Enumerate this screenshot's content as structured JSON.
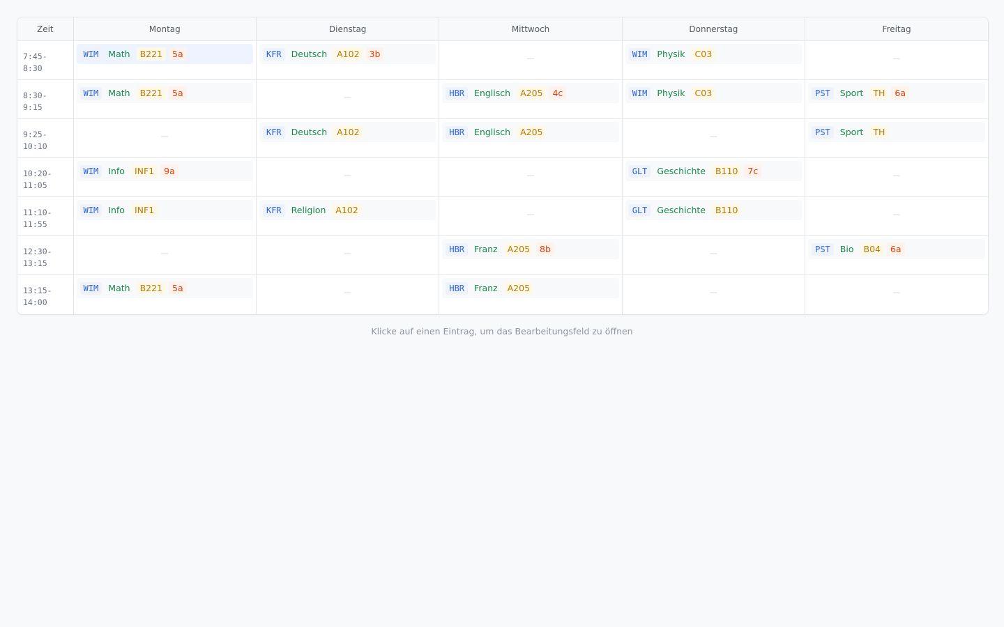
{
  "header": {
    "time_label": "Zeit",
    "days": [
      "Montag",
      "Dienstag",
      "Mittwoch",
      "Donnerstag",
      "Freitag"
    ]
  },
  "empty_marker": "—",
  "rows": [
    {
      "time": "7:45-\n8:30",
      "cells": [
        {
          "teacher": "WIM",
          "subject": "Math",
          "room": "B221",
          "class": "5a",
          "selected": true
        },
        {
          "teacher": "KFR",
          "subject": "Deutsch",
          "room": "A102",
          "class": "3b"
        },
        null,
        {
          "teacher": "WIM",
          "subject": "Physik",
          "room": "C03"
        },
        null
      ]
    },
    {
      "time": "8:30-\n9:15",
      "cells": [
        {
          "teacher": "WIM",
          "subject": "Math",
          "room": "B221",
          "class": "5a"
        },
        null,
        {
          "teacher": "HBR",
          "subject": "Englisch",
          "room": "A205",
          "class": "4c"
        },
        {
          "teacher": "WIM",
          "subject": "Physik",
          "room": "C03"
        },
        {
          "teacher": "PST",
          "subject": "Sport",
          "room": "TH",
          "class": "6a"
        }
      ]
    },
    {
      "time": "9:25-\n10:10",
      "cells": [
        null,
        {
          "teacher": "KFR",
          "subject": "Deutsch",
          "room": "A102"
        },
        {
          "teacher": "HBR",
          "subject": "Englisch",
          "room": "A205"
        },
        null,
        {
          "teacher": "PST",
          "subject": "Sport",
          "room": "TH"
        }
      ]
    },
    {
      "time": "10:20-\n11:05",
      "cells": [
        {
          "teacher": "WIM",
          "subject": "Info",
          "room": "INF1",
          "class": "9a"
        },
        null,
        null,
        {
          "teacher": "GLT",
          "subject": "Geschichte",
          "room": "B110",
          "class": "7c"
        },
        null
      ]
    },
    {
      "time": "11:10-\n11:55",
      "cells": [
        {
          "teacher": "WIM",
          "subject": "Info",
          "room": "INF1"
        },
        {
          "teacher": "KFR",
          "subject": "Religion",
          "room": "A102"
        },
        null,
        {
          "teacher": "GLT",
          "subject": "Geschichte",
          "room": "B110"
        },
        null
      ]
    },
    {
      "time": "12:30-\n13:15",
      "cells": [
        null,
        null,
        {
          "teacher": "HBR",
          "subject": "Franz",
          "room": "A205",
          "class": "8b"
        },
        null,
        {
          "teacher": "PST",
          "subject": "Bio",
          "room": "B04",
          "class": "6a"
        }
      ]
    },
    {
      "time": "13:15-\n14:00",
      "cells": [
        {
          "teacher": "WIM",
          "subject": "Math",
          "room": "B221",
          "class": "5a"
        },
        null,
        {
          "teacher": "HBR",
          "subject": "Franz",
          "room": "A205"
        },
        null,
        null
      ]
    }
  ],
  "hint": "Klicke auf einen Eintrag, um das Bearbeitungsfeld zu öffnen",
  "colors": {
    "teacher": "#2e63d9",
    "subject": "#17894a",
    "room": "#b57a09",
    "class": "#d4410f",
    "selected_bg": "#eef4ff"
  }
}
